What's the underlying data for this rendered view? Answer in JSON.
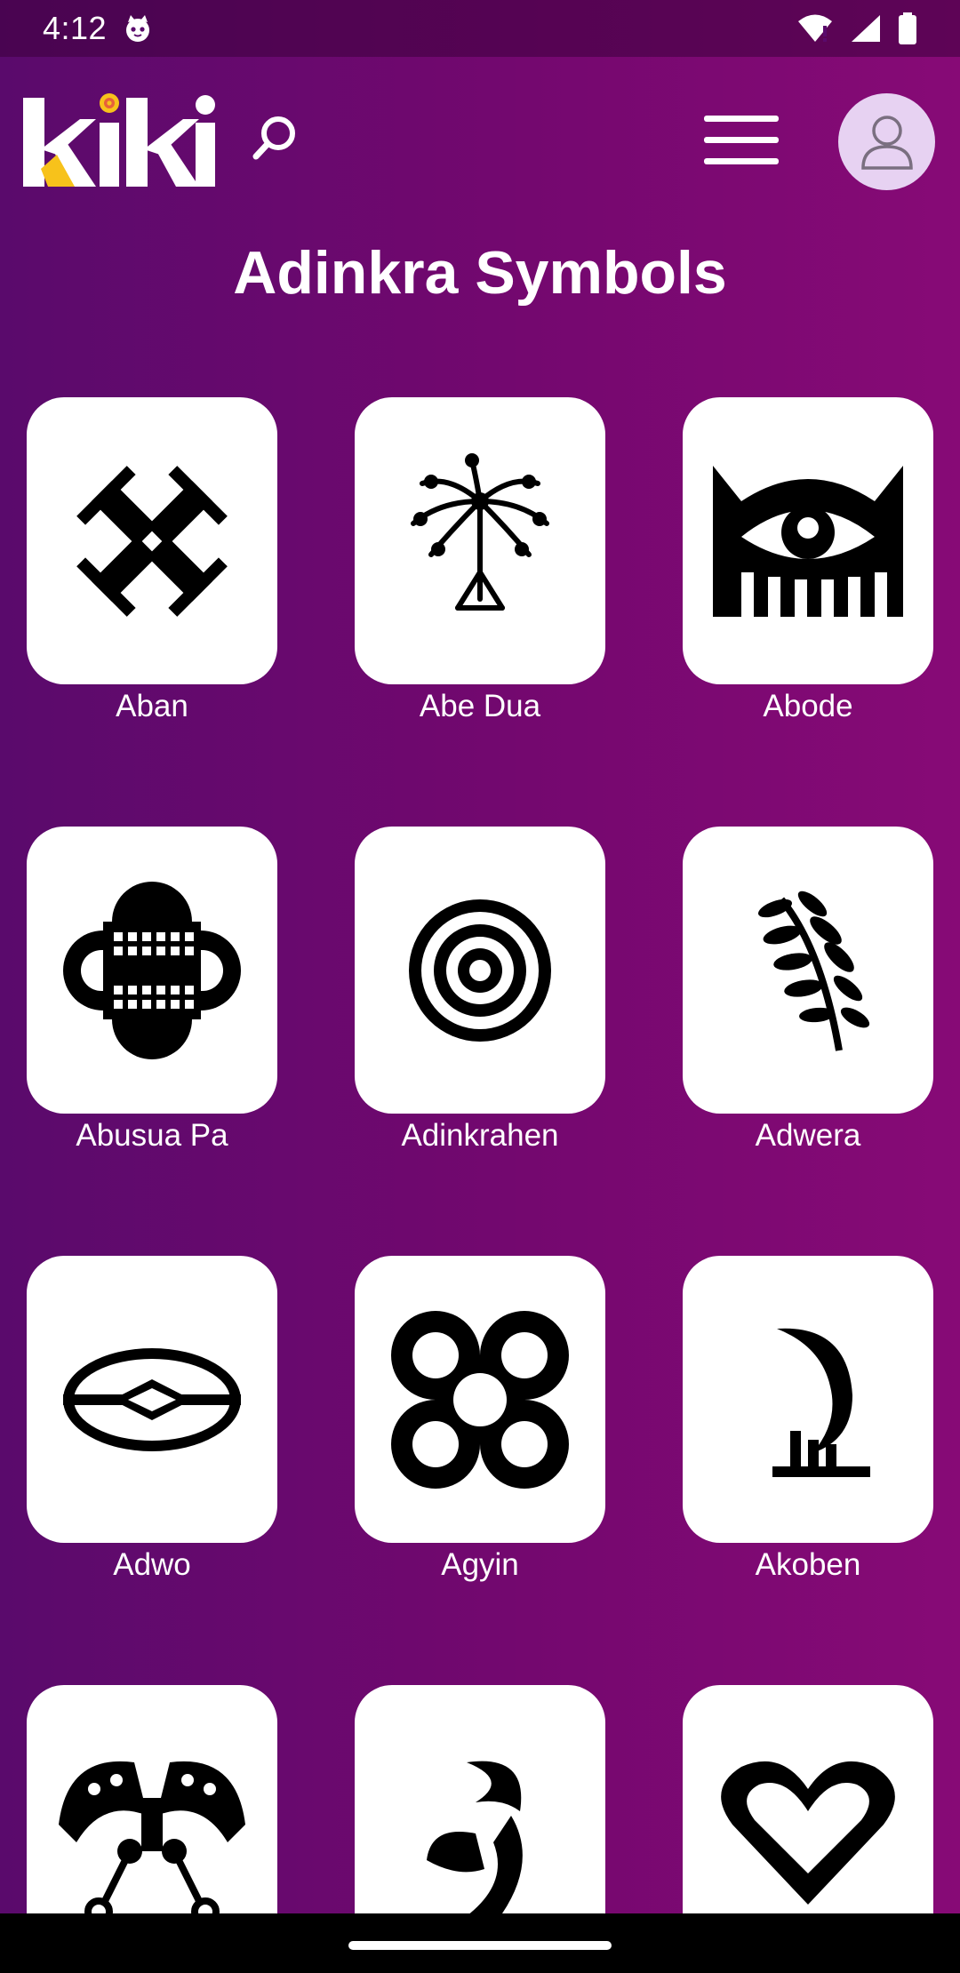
{
  "status": {
    "time": "4:12"
  },
  "header": {
    "logo_text": "kiki",
    "brand_accent": "#f7c21b",
    "logo_dot": "#e7603b"
  },
  "page": {
    "title": "Adinkra Symbols"
  },
  "symbols": [
    {
      "name": "Aban",
      "icon": "aban-icon"
    },
    {
      "name": "Abe Dua",
      "icon": "abe-dua-icon"
    },
    {
      "name": "Abode",
      "icon": "abode-icon"
    },
    {
      "name": "Abusua Pa",
      "icon": "abusua-pa-icon"
    },
    {
      "name": "Adinkrahen",
      "icon": "adinkrahen-icon"
    },
    {
      "name": "Adwera",
      "icon": "adwera-icon"
    },
    {
      "name": "Adwo",
      "icon": "adwo-icon"
    },
    {
      "name": "Agyin",
      "icon": "agyin-icon"
    },
    {
      "name": "Akoben",
      "icon": "akoben-icon"
    },
    {
      "name": "",
      "icon": "akoko-nan-icon"
    },
    {
      "name": "",
      "icon": "akofena-icon"
    },
    {
      "name": "",
      "icon": "akoma-icon"
    }
  ]
}
